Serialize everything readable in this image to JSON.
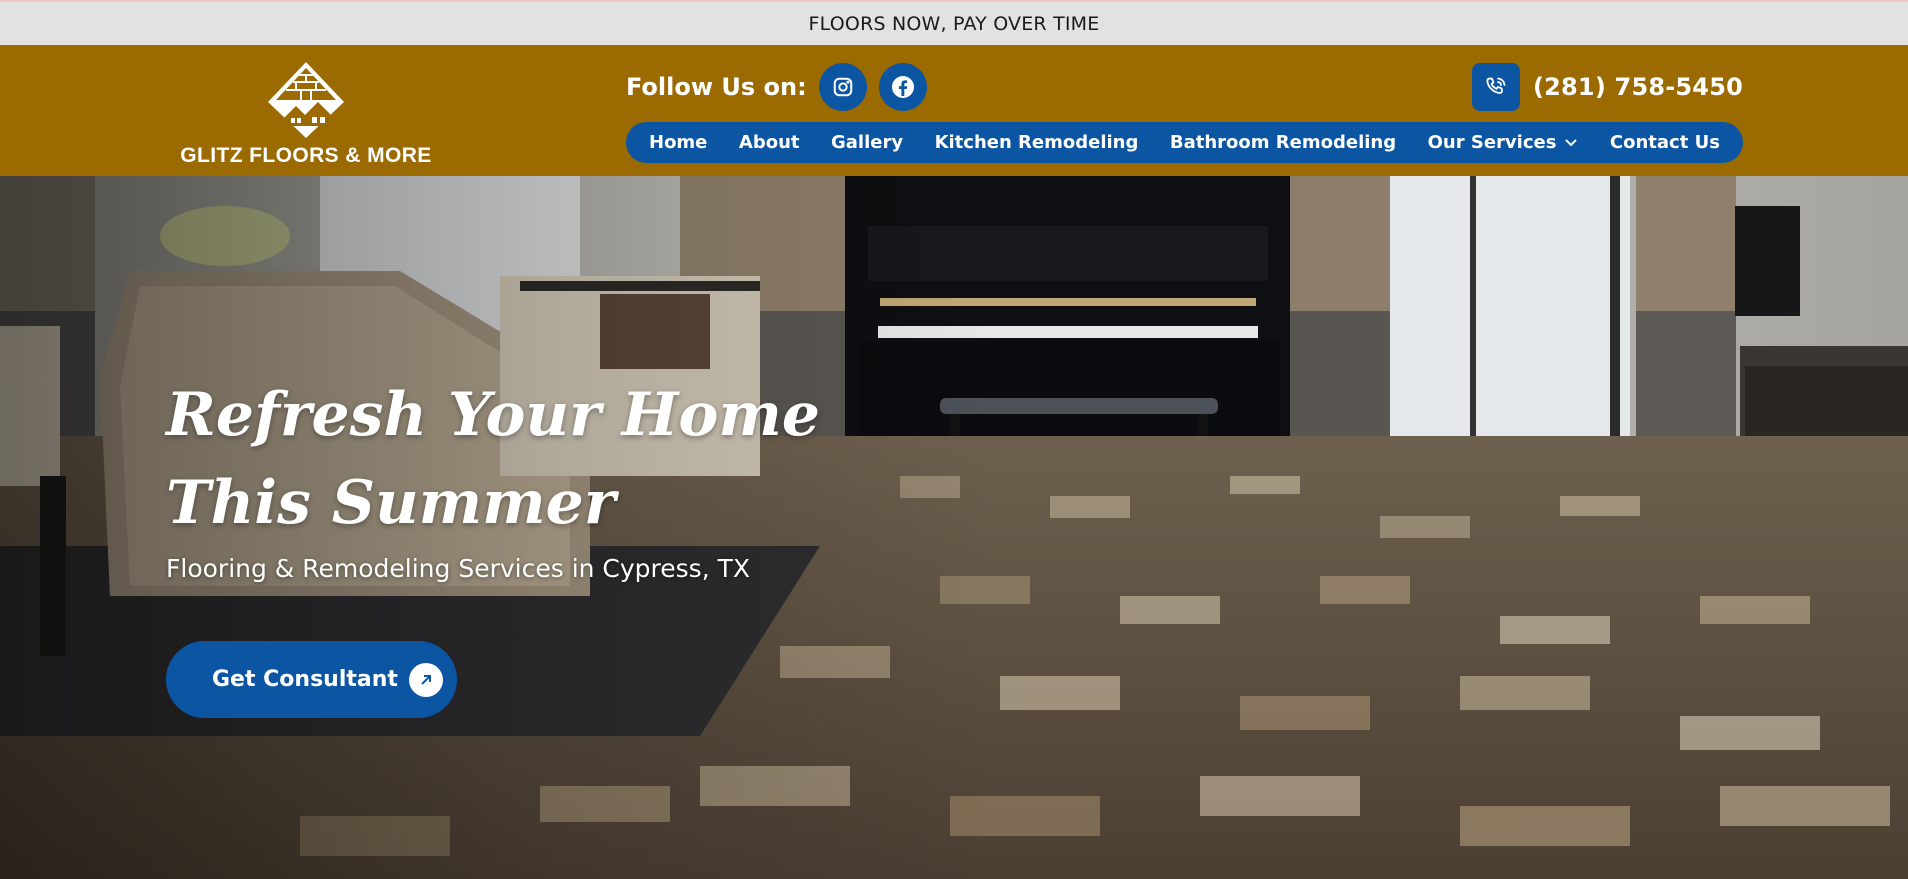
{
  "announcement": {
    "text": "FLOORS NOW, PAY OVER TIME"
  },
  "brand": {
    "name": "GLITZ FLOORS & MORE",
    "logo_icon": "house-roof-logo-icon"
  },
  "social": {
    "label": "Follow Us on:",
    "links": [
      {
        "name": "Instagram",
        "icon": "instagram-icon"
      },
      {
        "name": "Facebook",
        "icon": "facebook-icon"
      }
    ]
  },
  "contact": {
    "phone": "(281) 758-5450",
    "icon": "phone-icon"
  },
  "nav": {
    "items": [
      {
        "label": "Home"
      },
      {
        "label": "About"
      },
      {
        "label": "Gallery"
      },
      {
        "label": "Kitchen Remodeling"
      },
      {
        "label": "Bathroom Remodeling"
      },
      {
        "label": "Our Services",
        "has_dropdown": true
      },
      {
        "label": "Contact Us"
      }
    ]
  },
  "hero": {
    "title_line1": "Refresh Your Home",
    "title_line2": "This Summer",
    "subtitle": "Flooring & Remodeling Services in Cypress, TX",
    "cta_label": "Get Consultant",
    "cta_icon": "arrow-up-right-icon"
  },
  "colors": {
    "header_bg": "#9b6a00",
    "accent_blue": "#0b55a2",
    "topbar_bg": "#e2e2e0"
  }
}
